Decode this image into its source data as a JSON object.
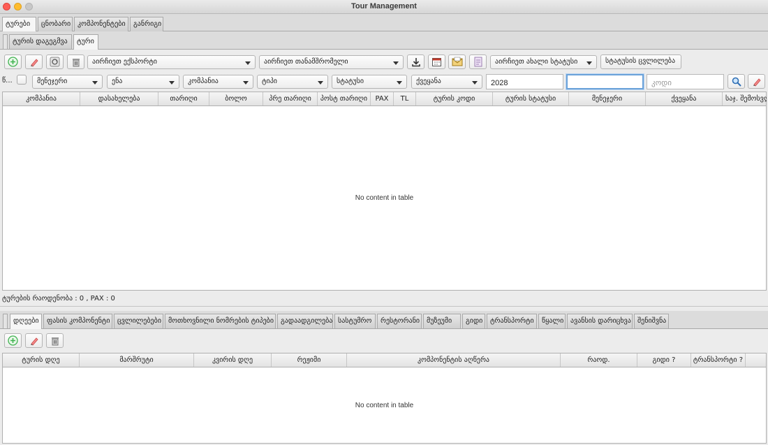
{
  "window": {
    "title": "Tour Management"
  },
  "main_tabs": [
    "ტურები",
    "ცნობარი",
    "კომპონენტები",
    "განრიგი"
  ],
  "sub_tabs": [
    "ტურის დაგეგმვა",
    "ტური"
  ],
  "toolbar": {
    "expert_combo": "აირჩიეთ ექსპორტი",
    "companion_combo": "აირჩიეთ თანამშრომელი",
    "status_combo": "აირჩიეთ ახალი სტატუსი",
    "change_status_label": "სტატუსის ცვლილება"
  },
  "filters": {
    "year_label": "წ...",
    "manager": "მენეჯერი",
    "language": "ენა",
    "company": "კომპანია",
    "type": "ტიპი",
    "status": "სტატუსი",
    "country": "ქვეყანა",
    "year_value": "2028",
    "search_value": "",
    "code_placeholder": "კოდი"
  },
  "tours_table": {
    "columns": [
      "კომპანია",
      "დასახელება",
      "თარიღი",
      "ბოლო",
      "პრე თარიღი",
      "პოსტ თარიღი",
      "PAX",
      "TL",
      "ტურის კოდი",
      "ტურის სტატუსი",
      "მენეჯერი",
      "ქვეყანა",
      "საჯ. შემოსვლ"
    ],
    "empty_text": "No content in table"
  },
  "tours_summary": "ტურების რაოდენობა : 0 , PAX : 0",
  "detail_tabs": [
    "დღეები",
    "ფასის კომპონენტი",
    "ცვლილებები",
    "მოთხოვნილი ნომრების ტიპები",
    "გადაადგილება",
    "სასტუმრო",
    "რესტორანი",
    "მუზეუმი",
    "გიდი",
    "ტრანსპორტი",
    "წყალი",
    "ავანსის დარიცხვა",
    "შენიშვნა"
  ],
  "days_table": {
    "columns": [
      "ტურის დღე",
      "მარშრუტი",
      "კვირის დღე",
      "რეჟიმი",
      "კომპონენტის აღწერა",
      "რაოდ.",
      "გიდი ?",
      "ტრანსპორტი ?"
    ],
    "empty_text": "No content in table"
  },
  "icons": [
    "add-icon",
    "edit-icon",
    "refresh-icon",
    "delete-icon",
    "download-icon",
    "calendar-icon",
    "mail-icon",
    "document-icon",
    "search-icon",
    "clear-icon"
  ],
  "colors": {
    "add": "#3fb34f",
    "accent": "#6ba2d9",
    "close": "#fe5f57",
    "minimize": "#febc2e"
  }
}
